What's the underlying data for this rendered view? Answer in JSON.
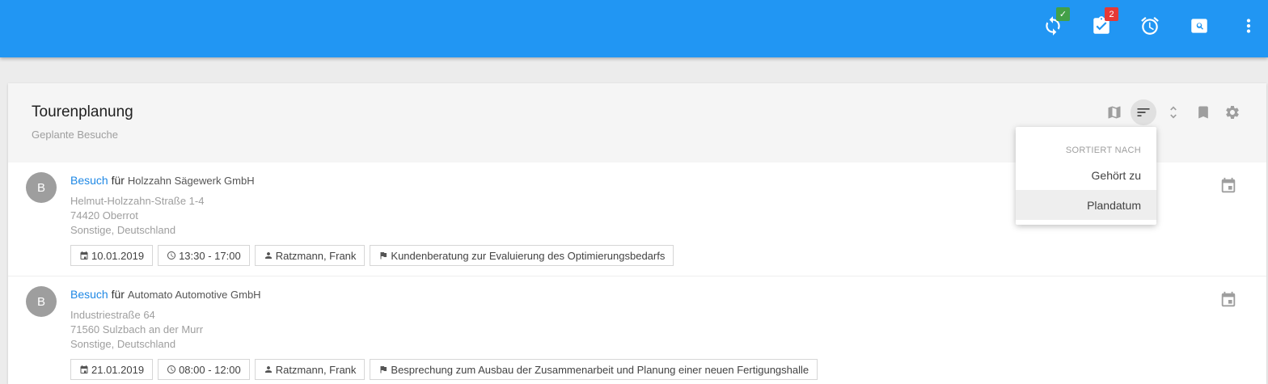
{
  "topbar": {
    "sync_badge": "✓",
    "tasks_badge": "2",
    "icons": [
      "sync-icon",
      "tasks-icon",
      "alarm-icon",
      "search-icon",
      "more-vert-icon"
    ]
  },
  "panel": {
    "title": "Tourenplanung",
    "subtitle": "Geplante Besuche",
    "header_icons": [
      "map-icon",
      "sort-icon",
      "expand-icon",
      "bookmark-icon",
      "settings-icon"
    ]
  },
  "sort_menu": {
    "heading": "SORTIERT NACH",
    "items": [
      {
        "label": "Gehört zu",
        "selected": false
      },
      {
        "label": "Plandatum",
        "selected": true
      }
    ]
  },
  "visits": [
    {
      "avatar": "B",
      "type": "Besuch",
      "connector": "für",
      "company": "Holzzahn Sägewerk GmbH",
      "street": "Helmut-Holzzahn-Straße 1-4",
      "city": "74420 Oberrot",
      "country": "Sonstige, Deutschland",
      "date": "10.01.2019",
      "time": "13:30 - 17:00",
      "person": "Ratzmann, Frank",
      "topic": "Kundenberatung zur Evaluierung des Optimierungsbedarfs"
    },
    {
      "avatar": "B",
      "type": "Besuch",
      "connector": "für",
      "company": "Automato Automotive GmbH",
      "street": "Industriestraße 64",
      "city": "71560 Sulzbach an der Murr",
      "country": "Sonstige, Deutschland",
      "date": "21.01.2019",
      "time": "08:00 - 12:00",
      "person": "Ratzmann, Frank",
      "topic": "Besprechung zum Ausbau der Zusammenarbeit und Planung einer neuen Fertigungshalle"
    }
  ],
  "colors": {
    "topbar": "#2196f3",
    "link": "#1e88e5",
    "badge_green": "#43a047",
    "badge_red": "#e53935"
  }
}
